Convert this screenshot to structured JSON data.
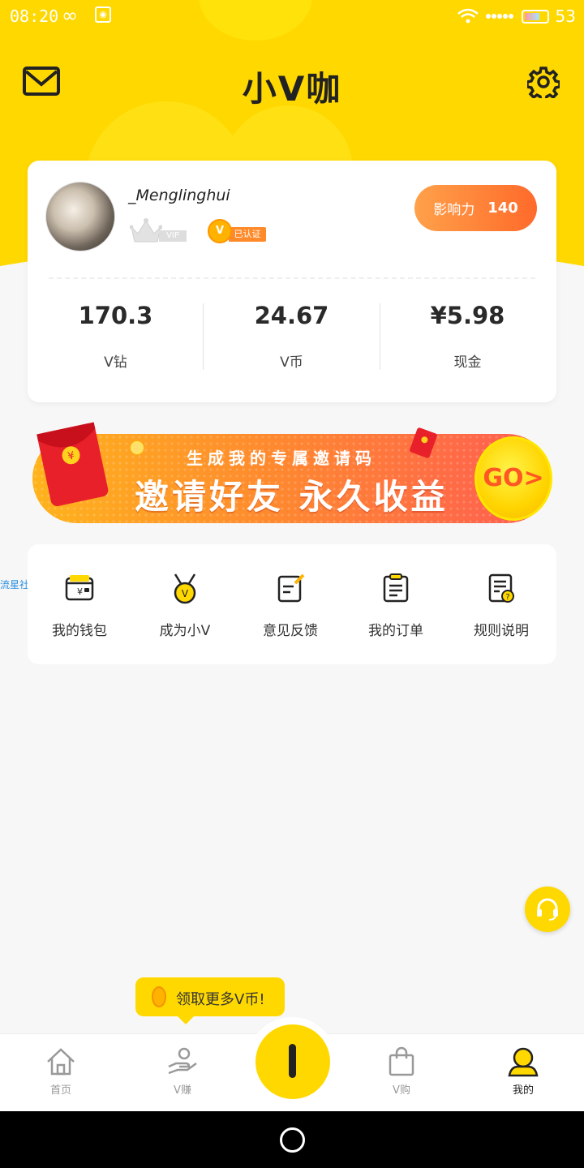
{
  "status_bar": {
    "time": "08:20",
    "battery": "53"
  },
  "header": {
    "title": "小V咖"
  },
  "profile": {
    "username": "_Menglinghui",
    "vip_label": "VIP",
    "verified_label": "已认证",
    "influence_label": "影响力",
    "influence_value": "140",
    "stats": [
      {
        "value": "170.3",
        "label": "V钻"
      },
      {
        "value": "24.67",
        "label": "V币"
      },
      {
        "value": "¥5.98",
        "label": "现金"
      }
    ]
  },
  "banner": {
    "subtitle": "生成我的专属邀请码",
    "title": "邀请好友 永久收益",
    "go_label": "GO>"
  },
  "side_tag": "流星社区",
  "menu": [
    {
      "label": "我的钱包",
      "icon": "wallet-icon"
    },
    {
      "label": "成为小V",
      "icon": "medal-icon"
    },
    {
      "label": "意见反馈",
      "icon": "feedback-icon"
    },
    {
      "label": "我的订单",
      "icon": "clipboard-icon"
    },
    {
      "label": "规则说明",
      "icon": "rules-icon"
    }
  ],
  "tooltip": {
    "text": "领取更多V币!"
  },
  "tabs": [
    {
      "label": "首页",
      "icon": "home-icon"
    },
    {
      "label": "V赚",
      "icon": "earn-icon"
    },
    {
      "label": "V购",
      "icon": "shopping-bag-icon"
    },
    {
      "label": "我的",
      "icon": "user-icon"
    }
  ],
  "colors": {
    "brand": "#ffd800",
    "accent": "#ff6a2a"
  }
}
